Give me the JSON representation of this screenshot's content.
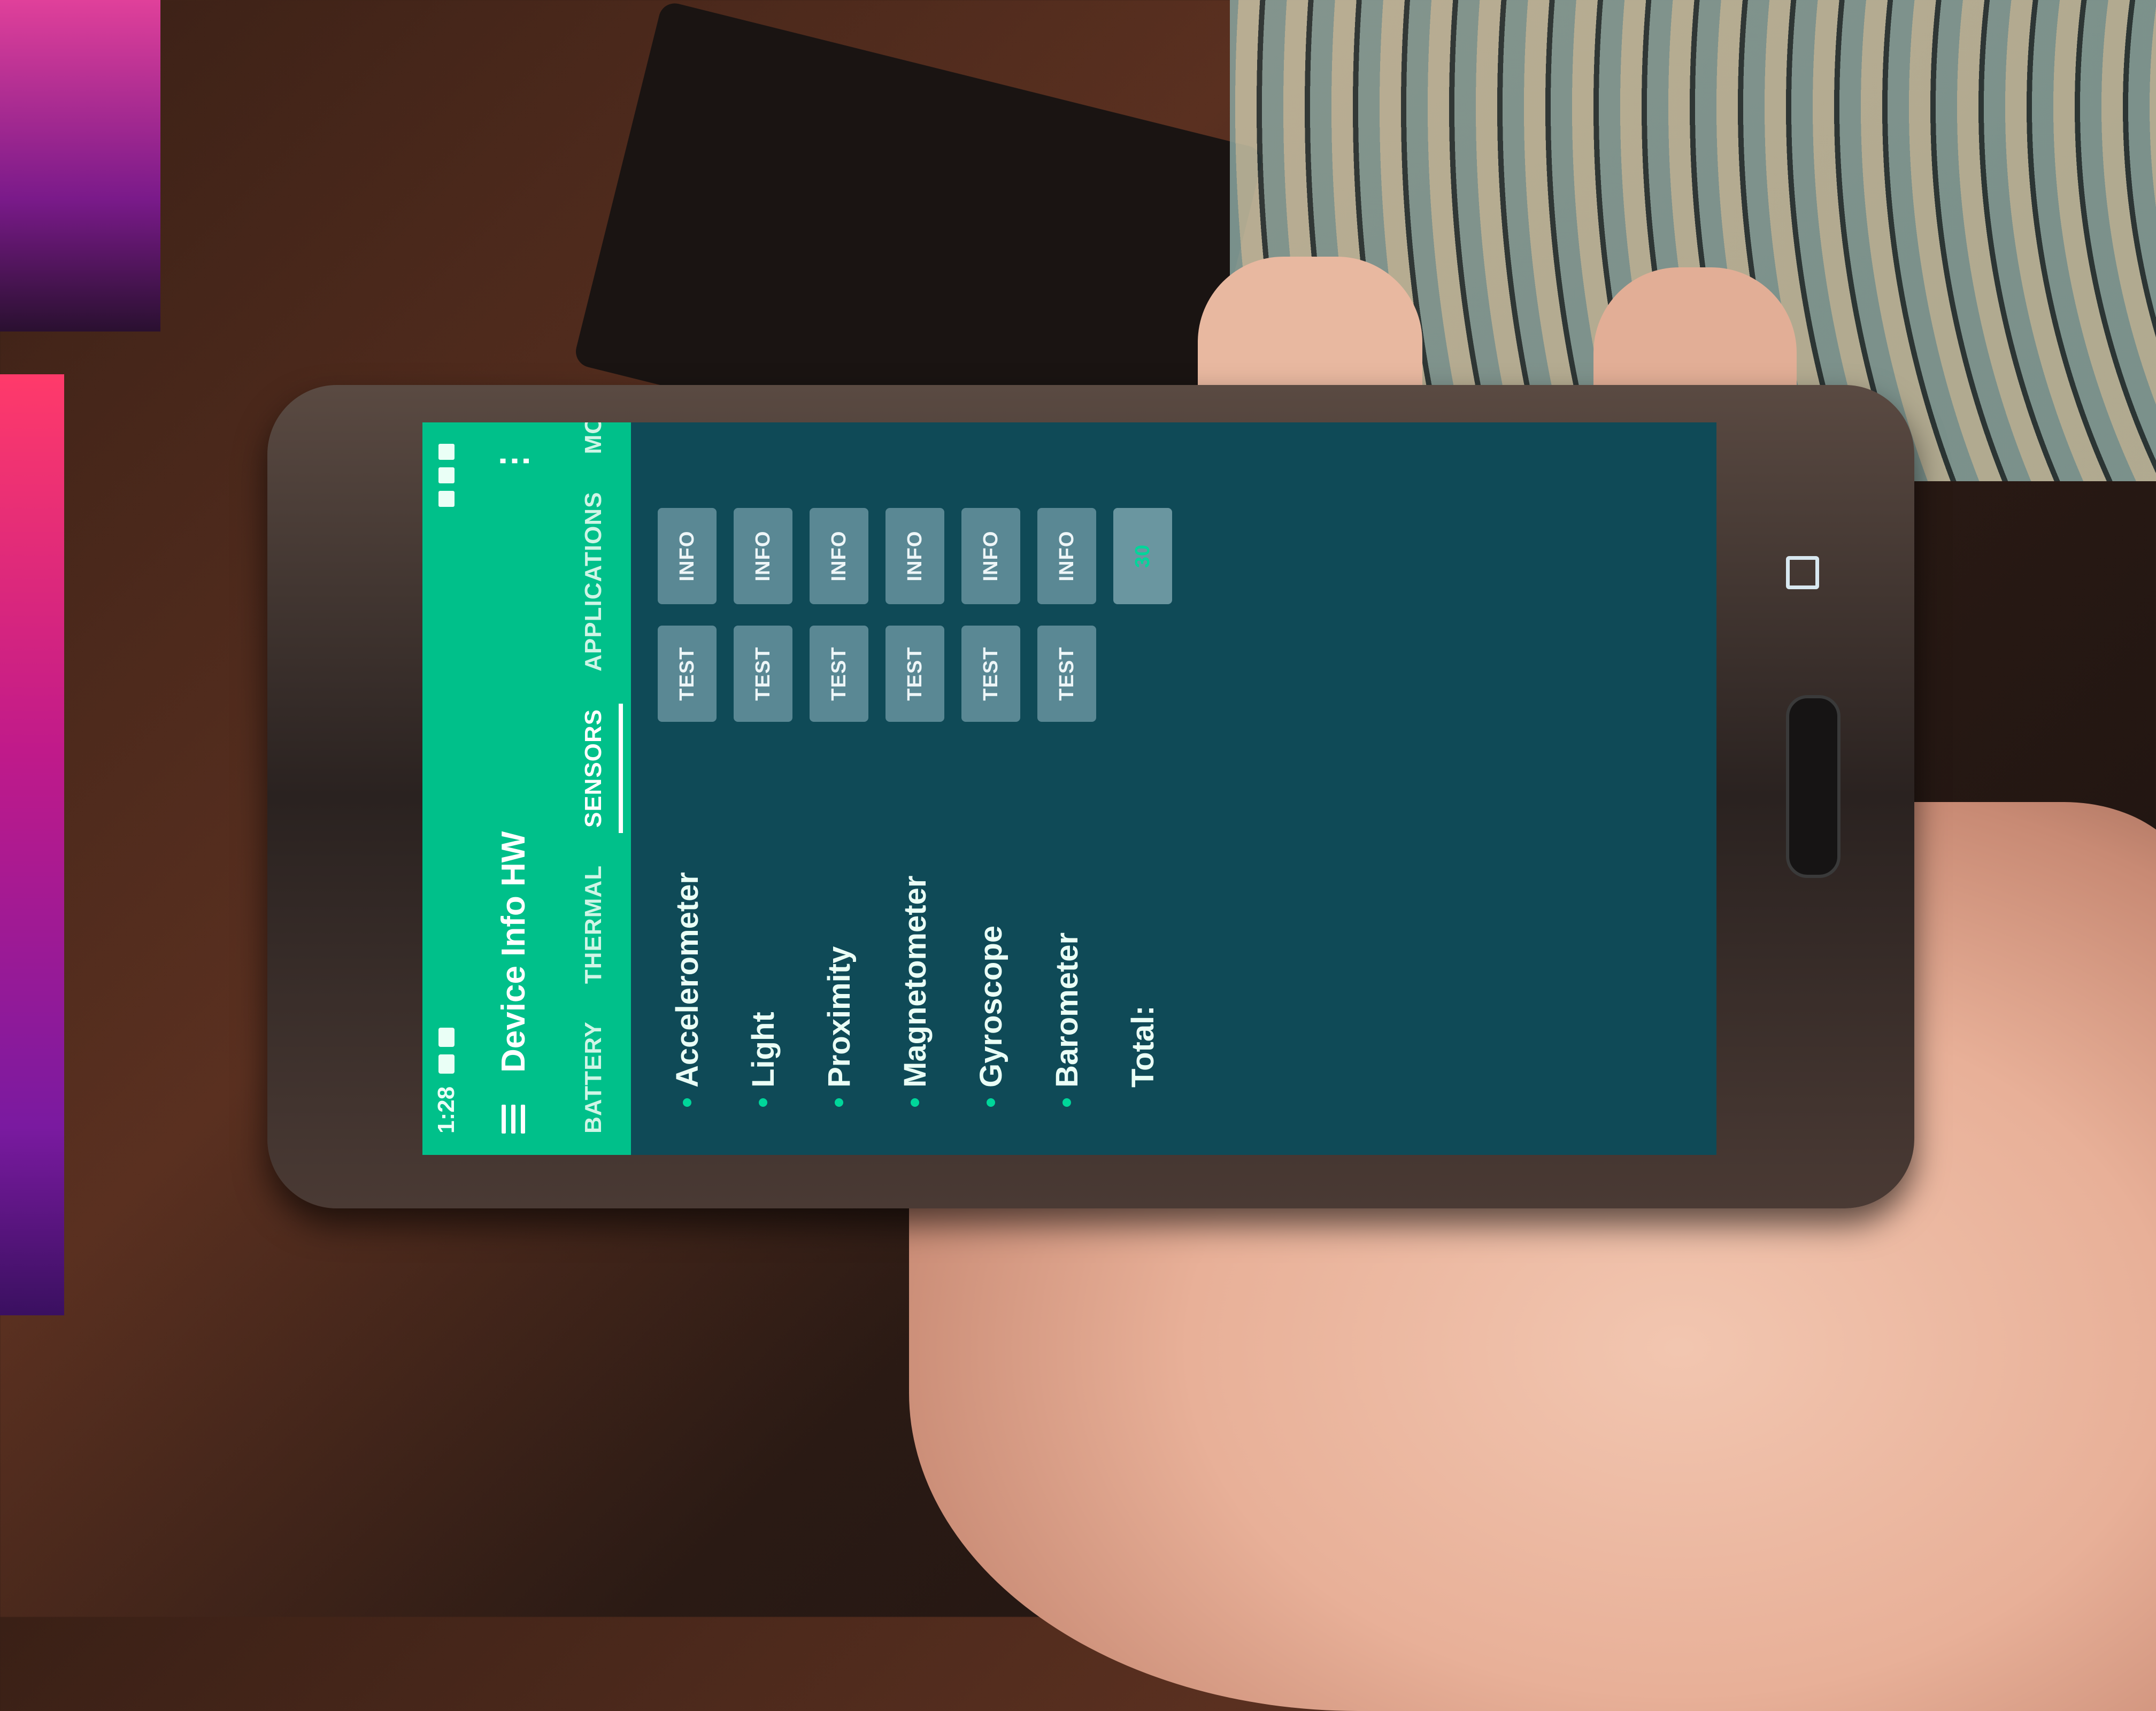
{
  "status_bar": {
    "time": "1:28"
  },
  "toolbar": {
    "title": "Device Info HW",
    "overflow": "⋮"
  },
  "tabs": [
    {
      "label": "BATTERY",
      "active": false
    },
    {
      "label": "THERMAL",
      "active": false
    },
    {
      "label": "SENSORS",
      "active": true
    },
    {
      "label": "APPLICATIONS",
      "active": false
    },
    {
      "label": "MOUN",
      "active": false
    }
  ],
  "sensors": [
    {
      "name": "Accelerometer",
      "test_label": "TEST",
      "info_label": "INFO"
    },
    {
      "name": "Light",
      "test_label": "TEST",
      "info_label": "INFO"
    },
    {
      "name": "Proximity",
      "test_label": "TEST",
      "info_label": "INFO"
    },
    {
      "name": "Magnetometer",
      "test_label": "TEST",
      "info_label": "INFO"
    },
    {
      "name": "Gyroscope",
      "test_label": "TEST",
      "info_label": "INFO"
    },
    {
      "name": "Barometer",
      "test_label": "TEST",
      "info_label": "INFO"
    }
  ],
  "total": {
    "label": "Total:",
    "value": "30"
  },
  "colors": {
    "appbar": "#00c08a",
    "background": "#0f4a57",
    "button": "#5a8894",
    "accent": "#00d69a"
  }
}
